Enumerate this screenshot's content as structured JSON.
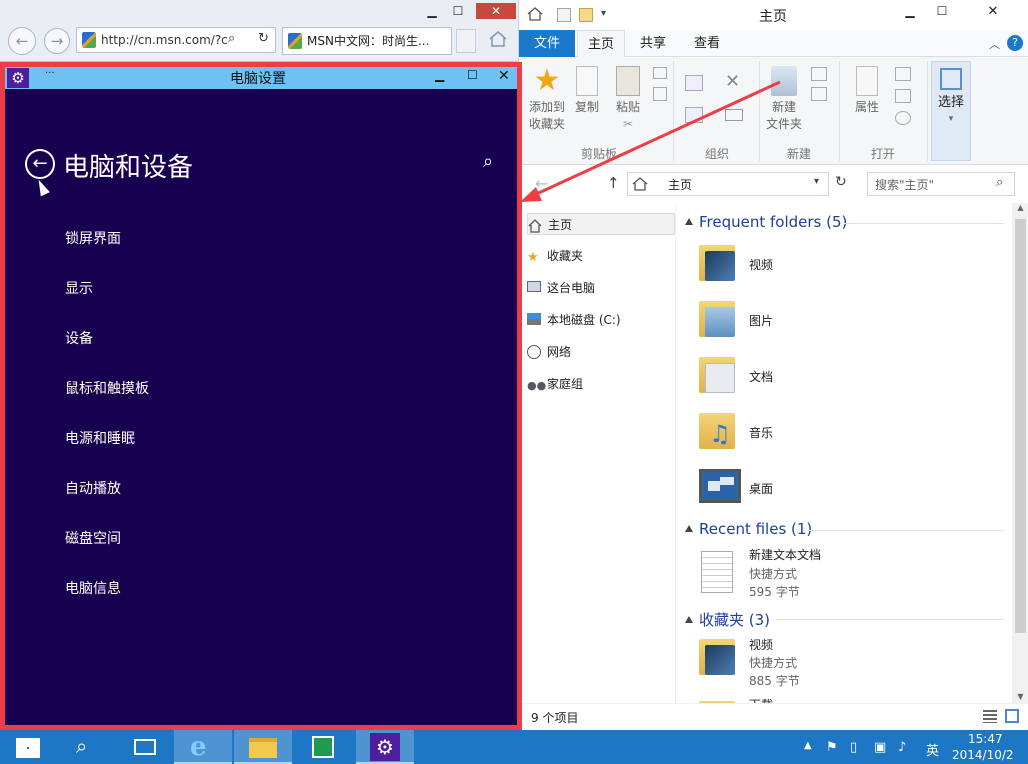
{
  "ie": {
    "address": "http://cn.msn.com/?c",
    "tab_title": "MSN中文网：时尚生..."
  },
  "explorer": {
    "title": "主页",
    "ribbon_tabs": [
      "文件",
      "主页",
      "共享",
      "查看"
    ],
    "ribbon": {
      "add_favorites": "添加到\n收藏夹",
      "copy": "复制",
      "paste": "粘贴",
      "clipboard_group": "剪贴板",
      "organize_group": "组织",
      "new_folder": "新建\n文件夹",
      "new_group": "新建",
      "properties": "属性",
      "open_group": "打开",
      "select": "选择"
    },
    "address_path": "主页",
    "search_placeholder": "搜索\"主页\"",
    "nav_items": [
      "主页",
      "收藏夹",
      "这台电脑",
      "本地磁盘 (C:)",
      "网络",
      "家庭组"
    ],
    "frequent_header": "Frequent folders (5)",
    "frequent_folders": [
      "视频",
      "图片",
      "文档",
      "音乐",
      "桌面"
    ],
    "recent_header": "Recent files (1)",
    "recent_file": {
      "name": "新建文本文档",
      "type": "快捷方式",
      "size": "595 字节"
    },
    "favorites_header": "收藏夹 (3)",
    "favorite_item": {
      "name": "视频",
      "type": "快捷方式",
      "size": "885 字节"
    },
    "favorite_item_next": "下载",
    "status_text": "9 个项目"
  },
  "settings": {
    "window_title": "电脑设置",
    "menu_dots": "···",
    "page_title": "电脑和设备",
    "menu_items": [
      "锁屏界面",
      "显示",
      "设备",
      "鼠标和触摸板",
      "电源和睡眠",
      "自动播放",
      "磁盘空间",
      "电脑信息"
    ]
  },
  "taskbar": {
    "time": "15:47",
    "date": "2014/10/2",
    "ime": "英"
  },
  "colors": {
    "settings_bg": "#17004f",
    "highlight_border": "#ee3e45",
    "taskbar": "#1d77c4",
    "settings_titlebar": "#6ec2f3",
    "ribbon_file_tab": "#1979ca"
  }
}
